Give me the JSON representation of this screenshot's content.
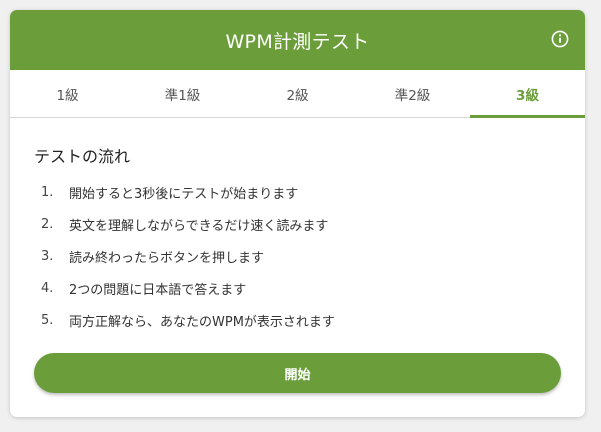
{
  "header": {
    "title": "WPM計測テスト",
    "info_icon": "info-circle-icon"
  },
  "tabs": [
    {
      "label": "1級",
      "active": false
    },
    {
      "label": "準1級",
      "active": false
    },
    {
      "label": "2級",
      "active": false
    },
    {
      "label": "準2級",
      "active": false
    },
    {
      "label": "3級",
      "active": true
    }
  ],
  "flow": {
    "title": "テストの流れ",
    "steps": [
      {
        "num": "1.",
        "text": "開始すると3秒後にテストが始まります"
      },
      {
        "num": "2.",
        "text": "英文を理解しながらできるだけ速く読みます"
      },
      {
        "num": "3.",
        "text": "読み終わったらボタンを押します"
      },
      {
        "num": "4.",
        "text": "2つの問題に日本語で答えます"
      },
      {
        "num": "5.",
        "text": "両方正解なら、あなたのWPMが表示されます"
      }
    ]
  },
  "start_button": {
    "label": "開始"
  },
  "colors": {
    "accent": "#6b9e3b",
    "background": "#f0f0f0",
    "card": "#ffffff"
  }
}
